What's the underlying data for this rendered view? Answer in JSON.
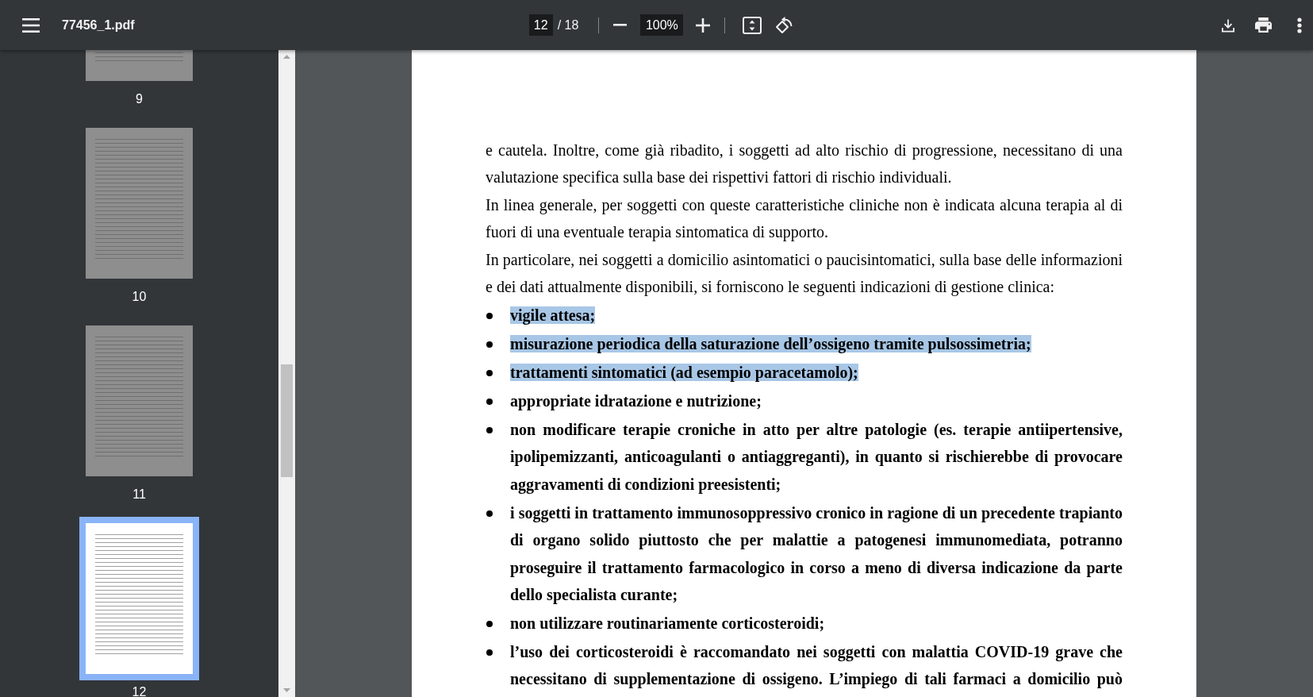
{
  "toolbar": {
    "title": "77456_1.pdf",
    "page_number": "12",
    "page_count": "/ 18",
    "zoom": "100%"
  },
  "sidebar": {
    "thumbnails": [
      {
        "label": "9",
        "selected": false
      },
      {
        "label": "10",
        "selected": false
      },
      {
        "label": "11",
        "selected": false
      },
      {
        "label": "12",
        "selected": true
      }
    ]
  },
  "document": {
    "paragraphs": [
      "e cautela. Inoltre, come già ribadito, i soggetti ad alto rischio di progressione, necessitano di una valutazione specifica sulla base dei rispettivi fattori di rischio individuali.",
      "In linea generale, per soggetti con queste caratteristiche cliniche non è indicata alcuna terapia al di fuori di una eventuale terapia sintomatica di supporto.",
      "In particolare, nei soggetti a domicilio asintomatici o paucisintomatici, sulla base delle informazioni e dei dati attualmente disponibili, si forniscono le seguenti indicazioni di gestione clinica:"
    ],
    "list": [
      {
        "text": "vigile attesa;",
        "highlighted": true
      },
      {
        "text": "misurazione periodica della saturazione dell’ossigeno tramite pulsossimetria;",
        "highlighted": true
      },
      {
        "text": "trattamenti sintomatici (ad esempio paracetamolo);",
        "highlighted": true
      },
      {
        "text": "appropriate idratazione e nutrizione;",
        "highlighted": false
      },
      {
        "text": "non modificare terapie croniche in atto per altre patologie (es. terapie antiipertensive, ipolipemizzanti, anticoagulanti o antiaggreganti), in quanto si rischierebbe di provocare aggravamenti di condizioni preesistenti;",
        "highlighted": false
      },
      {
        "text": "i soggetti in trattamento immunosoppressivo cronico in ragione di un precedente trapianto di organo solido piuttosto che per malattie a patogenesi immunomediata, potranno proseguire il trattamento farmacologico in corso a meno di diversa indicazione da parte dello specialista curante;",
        "highlighted": false
      },
      {
        "text": "non utilizzare routinariamente corticosteroidi;",
        "highlighted": false
      },
      {
        "text": "l’uso dei corticosteroidi è raccomandato nei soggetti con malattia COVID-19 grave che necessitano di supplementazione di ossigeno. L’impiego di tali farmaci a domicilio può",
        "highlighted": false
      }
    ]
  }
}
